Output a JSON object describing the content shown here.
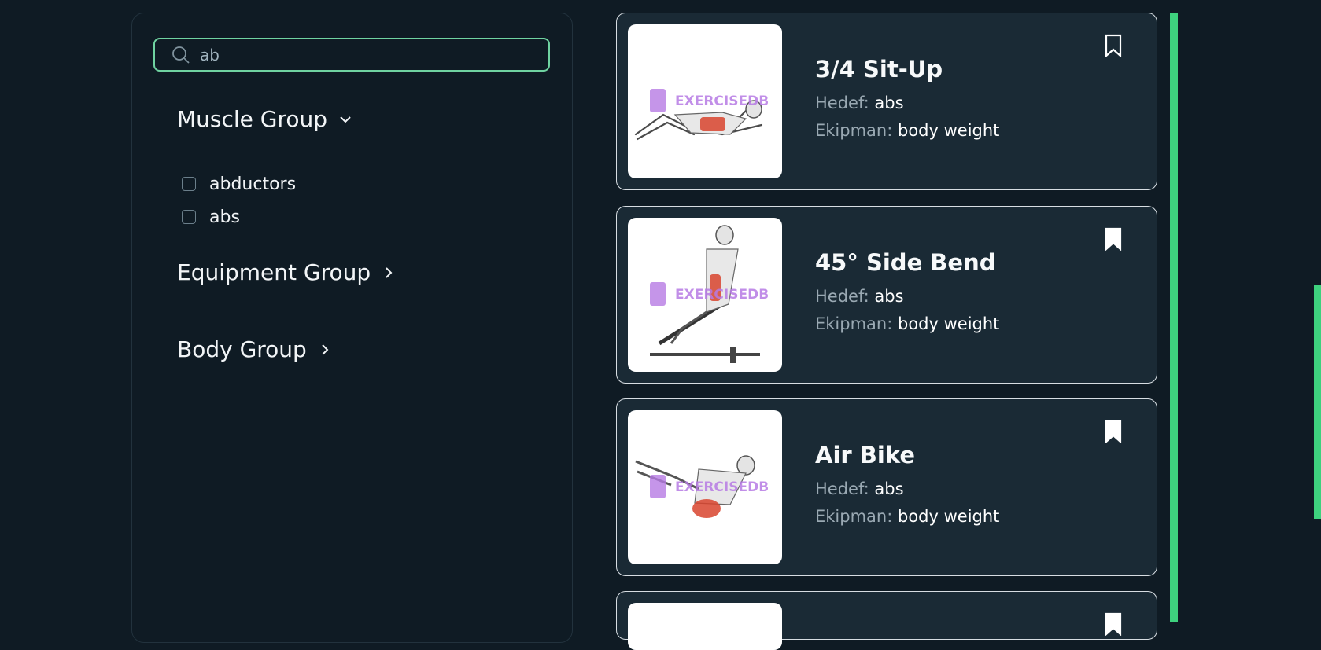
{
  "search": {
    "value": "ab",
    "placeholder": ""
  },
  "filters": {
    "muscle_group": {
      "title": "Muscle Group",
      "expanded": true,
      "options": [
        {
          "label": "abductors",
          "checked": false
        },
        {
          "label": "abs",
          "checked": false
        }
      ]
    },
    "equipment_group": {
      "title": "Equipment Group",
      "expanded": false
    },
    "body_group": {
      "title": "Body Group",
      "expanded": false
    }
  },
  "labels": {
    "target": "Hedef:",
    "equipment": "Ekipman:"
  },
  "exercises": [
    {
      "name": "3/4 Sit-Up",
      "target": "abs",
      "equipment": "body weight",
      "bookmarked": false,
      "watermark": "EXERCISEDB"
    },
    {
      "name": "45° Side Bend",
      "target": "abs",
      "equipment": "body weight",
      "bookmarked": true,
      "watermark": "EXERCISEDB"
    },
    {
      "name": "Air Bike",
      "target": "abs",
      "equipment": "body weight",
      "bookmarked": true,
      "watermark": "EXERCISEDB"
    }
  ],
  "colors": {
    "accent": "#6fd3a1",
    "scroll": "#3ed27e",
    "background": "#0f1b24",
    "card": "#1a2a35"
  },
  "icons": {
    "search": "search-icon",
    "expand": "chevron-down-icon",
    "collapsed": "chevron-right-icon",
    "bookmark": "bookmark-icon"
  }
}
